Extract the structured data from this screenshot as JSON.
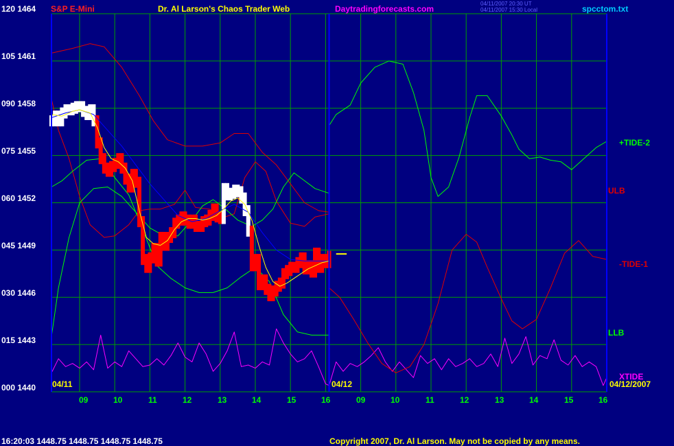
{
  "header": {
    "title_left": "S&P E-Mini",
    "title_center": "Dr. Al Larson's Chaos Trader Web",
    "site": "Daytradingforecasts.com",
    "timestamp_line1": "04/11/2007 20:30 UT",
    "timestamp_line2": "04/11/2007 15:30 Local",
    "filename": "spcctom.txt"
  },
  "footer": {
    "quote": "16:20:03  1448.75  1448.75  1448.75  1448.75",
    "copyright": "Copyright 2007, Dr. Al Larson. May not be copied by any means."
  },
  "colors": {
    "background": "#000080",
    "grid": "#00a000",
    "price_red": "#ff0000",
    "price_white": "#ffffff",
    "tide2": "#00ff00",
    "tide1": "#e00000",
    "xtide": "#ff00ff",
    "band": "#e00000",
    "ma_blue": "#0000ff",
    "ma_yellow": "#ffff00"
  },
  "chart_data": {
    "type": "line",
    "title": "S&P E-Mini",
    "y_ticks": [
      "120 1464",
      "105 1461",
      "090 1458",
      "075 1455",
      "060 1452",
      "045 1449",
      "030 1446",
      "015 1443",
      "000 1440"
    ],
    "ylim": [
      1440,
      1464
    ],
    "x_ticks_day1": [
      "09",
      "10",
      "11",
      "12",
      "13",
      "14",
      "15",
      "16"
    ],
    "x_ticks_day2": [
      "09",
      "10",
      "11",
      "12",
      "13",
      "14",
      "15",
      "16"
    ],
    "date_labels": [
      "04/11",
      "04/12",
      "04/12/2007"
    ],
    "series_labels": {
      "tide2": "+TIDE-2",
      "ulb": "ULB",
      "tide1": "-TIDE-1",
      "llb": "LLB",
      "xtide": "XTIDE"
    },
    "grid": true,
    "price": {
      "x": [
        8.2,
        8.3,
        8.4,
        8.5,
        8.6,
        8.7,
        8.8,
        8.9,
        9.0,
        9.1,
        9.2,
        9.3,
        9.4,
        9.5,
        9.6,
        9.7,
        9.8,
        9.9,
        10.0,
        10.1,
        10.2,
        10.3,
        10.4,
        10.5,
        10.6,
        10.7,
        10.8,
        10.9,
        11.0,
        11.1,
        11.2,
        11.3,
        11.4,
        11.5,
        11.6,
        11.7,
        11.8,
        11.9,
        12.0,
        12.1,
        12.2,
        12.3,
        12.4,
        12.5,
        12.6,
        12.7,
        12.8,
        12.9,
        13.0,
        13.1,
        13.2,
        13.3,
        13.4,
        13.5,
        13.6,
        13.7,
        13.8,
        13.9,
        14.0,
        14.1,
        14.2,
        14.3,
        14.4,
        14.5,
        14.6,
        14.7,
        14.8,
        14.9,
        15.0,
        15.1,
        15.2,
        15.3,
        15.4,
        15.5,
        15.6,
        15.7,
        15.8,
        15.9,
        16.0,
        16.1
      ],
      "y": [
        1457.2,
        1457.5,
        1457.2,
        1457.7,
        1457.9,
        1457.9,
        1458.0,
        1458.1,
        1458.1,
        1457.8,
        1457.6,
        1457.9,
        1457.2,
        1455.8,
        1454.8,
        1454.2,
        1454.0,
        1454.3,
        1454.5,
        1454.8,
        1454.2,
        1453.5,
        1453.0,
        1453.8,
        1453.3,
        1450.8,
        1448.4,
        1447.9,
        1448.5,
        1449.1,
        1448.3,
        1449.8,
        1449.3,
        1449.8,
        1450.1,
        1450.7,
        1450.9,
        1451.1,
        1450.9,
        1450.7,
        1450.9,
        1450.5,
        1450.5,
        1450.8,
        1450.9,
        1451.2,
        1451.6,
        1451.1,
        1451.0,
        1452.9,
        1452.5,
        1452.6,
        1452.8,
        1452.7,
        1452.3,
        1451.5,
        1450.2,
        1448.0,
        1448.4,
        1446.8,
        1447.1,
        1446.5,
        1446.1,
        1446.4,
        1446.7,
        1446.9,
        1447.5,
        1447.7,
        1447.9,
        1447.9,
        1448.2,
        1448.5,
        1447.8,
        1448.0,
        1447.6,
        1448.8,
        1447.9,
        1448.4,
        1448.2,
        1448.6
      ]
    },
    "ma_yellow": {
      "x": [
        8.2,
        8.5,
        8.8,
        9.0,
        9.3,
        9.5,
        9.7,
        9.9,
        10.1,
        10.3,
        10.5,
        10.7,
        10.9,
        11.1,
        11.3,
        11.5,
        11.7,
        11.9,
        12.1,
        12.3,
        12.5,
        12.7,
        12.9,
        13.1,
        13.3,
        13.5,
        13.7,
        13.9,
        14.1,
        14.3,
        14.5,
        14.7,
        14.9,
        15.1,
        15.3,
        15.5,
        15.7,
        15.9,
        16.1
      ],
      "y": [
        1457.6,
        1457.5,
        1457.8,
        1457.9,
        1457.7,
        1456.8,
        1455.5,
        1454.8,
        1454.6,
        1454.2,
        1453.4,
        1451.5,
        1449.8,
        1449.4,
        1449.3,
        1449.6,
        1450.3,
        1450.8,
        1451.0,
        1451.0,
        1450.9,
        1451.0,
        1451.2,
        1451.6,
        1452.1,
        1452.3,
        1451.9,
        1450.9,
        1449.3,
        1447.9,
        1447.0,
        1446.7,
        1446.9,
        1447.2,
        1447.5,
        1447.8,
        1448.0,
        1448.2,
        1448.3
      ],
      "forecast_mark": {
        "x": [
          16.3,
          16.6
        ],
        "y": [
          1448.75,
          1448.75
        ]
      }
    },
    "ma_blue": {
      "x": [
        8.2,
        8.6,
        9.0,
        9.4,
        9.8,
        10.2,
        10.6,
        11.0,
        11.4,
        11.8,
        12.2,
        12.6,
        13.0,
        13.4,
        13.8,
        14.2,
        14.6,
        15.0,
        15.4,
        15.8,
        16.1
      ],
      "y": [
        1457.4,
        1457.7,
        1457.9,
        1457.6,
        1456.6,
        1455.6,
        1454.4,
        1453.2,
        1452.2,
        1451.2,
        1450.8,
        1451.0,
        1451.5,
        1451.9,
        1451.4,
        1450.1,
        1449.0,
        1448.4,
        1448.3,
        1448.3,
        1448.3
      ]
    },
    "ulb": {
      "x": [
        8.2,
        8.8,
        9.3,
        9.7,
        10.2,
        10.7,
        11.1,
        11.5,
        12.0,
        12.5,
        13.0,
        13.4,
        13.8,
        14.2,
        14.6,
        15.0,
        15.4,
        15.8,
        16.1
      ],
      "y": [
        1461.5,
        1461.8,
        1462.1,
        1461.9,
        1460.6,
        1458.8,
        1457.2,
        1456.0,
        1455.6,
        1455.6,
        1455.8,
        1456.4,
        1456.4,
        1455.2,
        1454.4,
        1453.2,
        1452.0,
        1451.5,
        1451.4
      ]
    },
    "lower_red_band": {
      "x": [
        8.2,
        8.4,
        8.7,
        9.0,
        9.3,
        9.7,
        10.0,
        10.4,
        10.7,
        11.0,
        11.3,
        11.7,
        12.0,
        12.3,
        12.7,
        13.0,
        13.4,
        13.7,
        14.0,
        14.3,
        14.6,
        15.0,
        15.4,
        15.7,
        16.1
      ],
      "y": [
        1458.6,
        1456.6,
        1454.8,
        1452.4,
        1450.6,
        1449.8,
        1449.9,
        1450.6,
        1451.5,
        1451.6,
        1451.6,
        1451.9,
        1452.8,
        1451.7,
        1451.6,
        1451.0,
        1451.3,
        1453.6,
        1454.6,
        1454.0,
        1452.1,
        1450.7,
        1450.5,
        1451.1,
        1451.3
      ]
    },
    "llb": {
      "x": [
        8.2,
        8.5,
        8.8,
        9.2,
        9.6,
        10.0,
        10.4,
        10.8,
        11.2,
        11.6,
        12.0,
        12.4,
        12.8,
        13.2,
        13.6,
        14.0,
        14.4,
        14.8,
        15.2,
        15.6,
        16.1
      ],
      "y": [
        1453.0,
        1453.4,
        1454.0,
        1454.7,
        1454.8,
        1453.6,
        1452.5,
        1450.3,
        1448.0,
        1447.2,
        1446.6,
        1446.3,
        1446.3,
        1446.6,
        1447.3,
        1447.9,
        1447.0,
        1444.9,
        1443.8,
        1443.6,
        1443.6
      ]
    },
    "mid_green_band": {
      "x": [
        8.2,
        8.4,
        8.7,
        9.0,
        9.4,
        9.8,
        10.2,
        10.6,
        11.0,
        11.4,
        11.8,
        12.2,
        12.5,
        12.8,
        13.1,
        13.5,
        13.9,
        14.2,
        14.5,
        14.8,
        15.1,
        15.4,
        15.7,
        16.1
      ],
      "y": [
        1443.5,
        1446.6,
        1449.8,
        1452.0,
        1452.9,
        1453.0,
        1452.4,
        1451.4,
        1450.4,
        1449.9,
        1449.9,
        1450.9,
        1451.8,
        1452.2,
        1451.7,
        1450.9,
        1450.5,
        1450.9,
        1451.6,
        1453.0,
        1453.9,
        1453.4,
        1452.9,
        1452.6
      ]
    },
    "tide2_forecast": {
      "x": [
        16.1,
        16.3,
        16.7,
        17.0,
        17.4,
        17.8,
        18.2,
        18.5,
        18.8,
        19.0,
        19.2,
        19.5,
        19.8,
        20.1,
        20.3,
        20.6,
        21.0,
        21.3,
        21.5,
        21.8,
        22.1,
        22.4,
        22.7,
        23.0,
        23.2,
        23.4,
        23.7,
        24.0
      ],
      "y": [
        1456.9,
        1457.6,
        1458.2,
        1459.6,
        1460.6,
        1461.0,
        1460.8,
        1459.0,
        1456.6,
        1453.6,
        1452.4,
        1453.0,
        1454.9,
        1457.4,
        1458.8,
        1458.8,
        1457.5,
        1456.3,
        1455.4,
        1454.8,
        1454.9,
        1454.7,
        1454.6,
        1454.1,
        1454.5,
        1454.9,
        1455.5,
        1455.9
      ]
    },
    "tide1_forecast": {
      "x": [
        16.1,
        16.4,
        16.8,
        17.2,
        17.6,
        18.0,
        18.4,
        18.8,
        19.2,
        19.6,
        20.0,
        20.3,
        20.6,
        21.0,
        21.3,
        21.6,
        22.0,
        22.4,
        22.8,
        23.2,
        23.6,
        24.0
      ],
      "y": [
        1446.6,
        1446.0,
        1444.6,
        1443.1,
        1441.8,
        1441.2,
        1441.6,
        1443.0,
        1445.6,
        1449.0,
        1450.0,
        1449.5,
        1447.9,
        1445.9,
        1444.5,
        1444.0,
        1444.6,
        1446.6,
        1448.8,
        1449.6,
        1448.6,
        1448.4
      ]
    },
    "xtide": {
      "x": [
        8.2,
        8.4,
        8.6,
        8.8,
        9.0,
        9.2,
        9.4,
        9.6,
        9.8,
        10.0,
        10.2,
        10.4,
        10.6,
        10.8,
        11.0,
        11.2,
        11.4,
        11.6,
        11.8,
        12.0,
        12.2,
        12.4,
        12.6,
        12.8,
        13.0,
        13.2,
        13.4,
        13.6,
        13.8,
        14.0,
        14.2,
        14.4,
        14.6,
        14.8,
        15.0,
        15.2,
        15.4,
        15.6,
        15.8,
        16.0,
        16.1,
        16.3,
        16.5,
        16.7,
        16.9,
        17.1,
        17.3,
        17.5,
        17.7,
        17.9,
        18.1,
        18.3,
        18.5,
        18.7,
        18.9,
        19.1,
        19.3,
        19.5,
        19.7,
        19.9,
        20.1,
        20.3,
        20.5,
        20.7,
        20.9,
        21.1,
        21.3,
        21.5,
        21.7,
        21.9,
        22.1,
        22.3,
        22.5,
        22.7,
        22.9,
        23.1,
        23.3,
        23.5,
        23.7,
        23.9,
        24.0
      ],
      "y": [
        1441.2,
        1442.1,
        1441.6,
        1441.8,
        1441.5,
        1441.9,
        1441.4,
        1443.6,
        1441.5,
        1441.9,
        1441.6,
        1442.6,
        1442.1,
        1441.6,
        1441.7,
        1442.1,
        1441.7,
        1442.3,
        1443.1,
        1442.2,
        1441.9,
        1443.1,
        1442.4,
        1441.3,
        1441.8,
        1442.6,
        1443.8,
        1441.6,
        1441.7,
        1441.5,
        1441.9,
        1441.7,
        1444.0,
        1443.1,
        1442.4,
        1441.9,
        1442.1,
        1442.6,
        1441.6,
        1440.5,
        1440.4,
        1441.9,
        1441.3,
        1441.8,
        1441.6,
        1441.9,
        1442.3,
        1442.8,
        1441.9,
        1441.3,
        1441.9,
        1441.4,
        1440.9,
        1442.3,
        1441.8,
        1442.1,
        1441.4,
        1442.1,
        1441.6,
        1441.8,
        1442.1,
        1441.6,
        1441.8,
        1442.4,
        1441.6,
        1443.4,
        1441.8,
        1442.4,
        1443.5,
        1441.7,
        1442.3,
        1442.1,
        1443.3,
        1442.0,
        1441.7,
        1442.3,
        1441.6,
        1441.9,
        1441.6,
        1440.4,
        1440.9
      ]
    }
  }
}
